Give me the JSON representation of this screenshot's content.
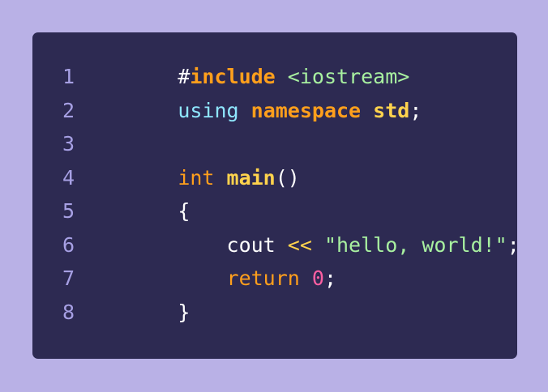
{
  "lines": [
    {
      "number": "1",
      "tokens": [
        {
          "text": "#",
          "color": "#ffffff"
        },
        {
          "text": "include",
          "color": "#ff9f1c"
        },
        {
          "text": " ",
          "color": "#ffffff"
        },
        {
          "text": "<iostream>",
          "color": "#a8f0a0"
        }
      ]
    },
    {
      "number": "2",
      "tokens": [
        {
          "text": "using",
          "color": "#8fe7ff"
        },
        {
          "text": " ",
          "color": "#ffffff"
        },
        {
          "text": "namespace",
          "color": "#ff9f1c"
        },
        {
          "text": " ",
          "color": "#ffffff"
        },
        {
          "text": "std",
          "color": "#ffd34d"
        },
        {
          "text": ";",
          "color": "#ffffff"
        }
      ]
    },
    {
      "number": "3",
      "tokens": []
    },
    {
      "number": "4",
      "tokens": [
        {
          "text": "int",
          "color": "#ff9f1c"
        },
        {
          "text": " ",
          "color": "#ffffff"
        },
        {
          "text": "main",
          "color": "#ffd34d"
        },
        {
          "text": "()",
          "color": "#ffffff"
        }
      ]
    },
    {
      "number": "5",
      "tokens": [
        {
          "text": "{",
          "color": "#ffffff"
        }
      ]
    },
    {
      "number": "6",
      "tokens": [
        {
          "text": "    cout ",
          "color": "#ffffff"
        },
        {
          "text": "<<",
          "color": "#ffd34d"
        },
        {
          "text": " ",
          "color": "#ffffff"
        },
        {
          "text": "\"hello, world!\"",
          "color": "#a8f0a0"
        },
        {
          "text": ";",
          "color": "#ffffff"
        }
      ]
    },
    {
      "number": "7",
      "tokens": [
        {
          "text": "    ",
          "color": "#ffffff"
        },
        {
          "text": "return",
          "color": "#ff9f1c"
        },
        {
          "text": " ",
          "color": "#ffffff"
        },
        {
          "text": "0",
          "color": "#ff5fa2"
        },
        {
          "text": ";",
          "color": "#ffffff"
        }
      ]
    },
    {
      "number": "8",
      "tokens": [
        {
          "text": "}",
          "color": "#ffffff"
        }
      ]
    }
  ]
}
